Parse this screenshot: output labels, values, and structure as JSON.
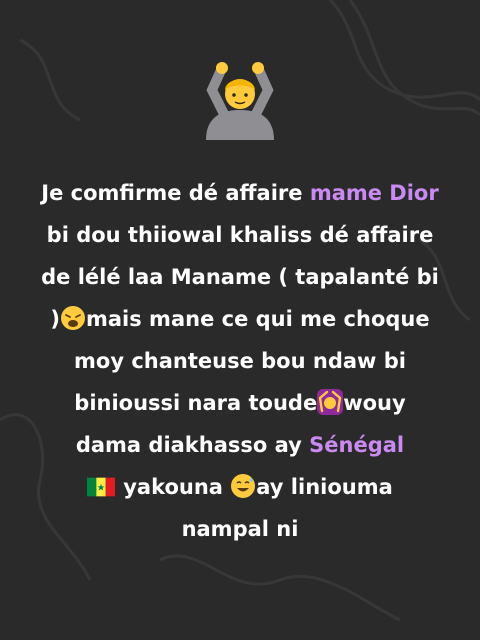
{
  "colors": {
    "background": "#2b2a2a",
    "text": "#ffffff",
    "highlight": "#c98bf1"
  },
  "icons": {
    "top": "person-gesturing-ok-icon",
    "inline": [
      "weary-face-icon",
      "woman-gesturing-ok-icon",
      "senegal-flag-icon",
      "grinning-face-with-sweat-icon"
    ]
  },
  "post": {
    "seg1": "Je comfirme dé affaire ",
    "name": "mame Dior",
    "seg2": " bi dou thiiowal khaliss dé affaire de lélé laa Maname ( tapalanté bi )",
    "seg3": "mais mane ce qui me choque moy chanteuse bou ndaw bi binioussi nara toude",
    "seg4": "wouy dama diakhasso ay ",
    "country": "Sénégal",
    "seg5": "yakouna ",
    "seg6": "ay liniouma nampal ni"
  }
}
